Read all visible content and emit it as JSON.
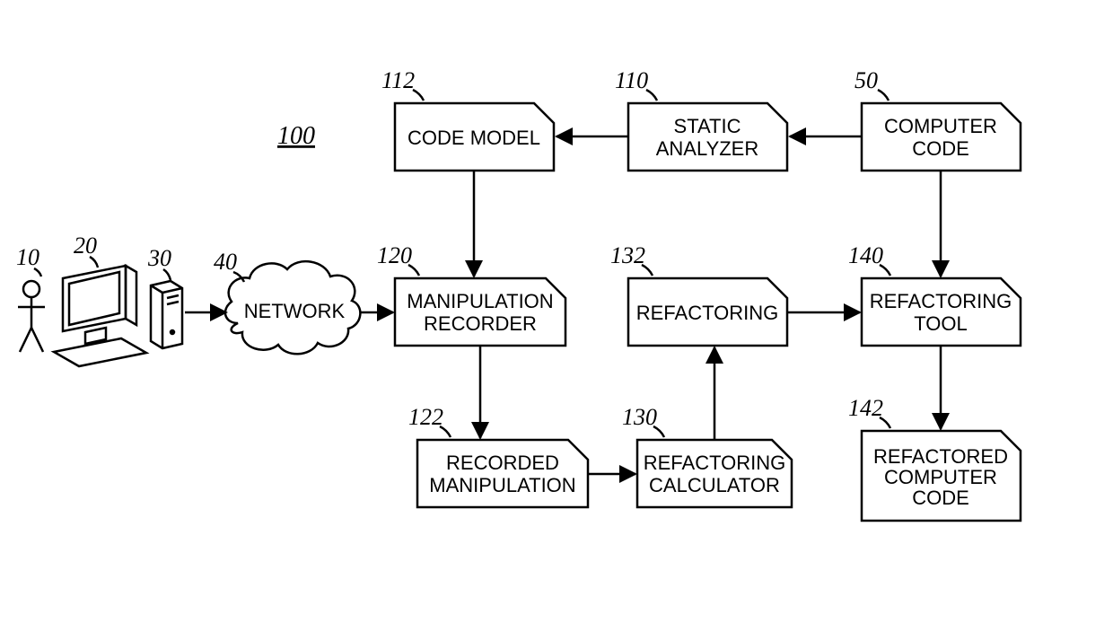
{
  "title": "100",
  "labels": {
    "user": "10",
    "monitor": "20",
    "tower": "30",
    "network": "40",
    "computerCode": "50",
    "staticAnalyzer": "110",
    "codeModel": "112",
    "manipRecorder": "120",
    "recordedManip": "122",
    "refactorCalc": "130",
    "refactoring": "132",
    "refactorTool": "140",
    "refactoredCode": "142"
  },
  "blocks": {
    "network": "NETWORK",
    "codeModel": "CODE MODEL",
    "staticAnalyzer": [
      "STATIC",
      "ANALYZER"
    ],
    "computerCode": [
      "COMPUTER",
      "CODE"
    ],
    "manipRecorder": [
      "MANIPULATION",
      "RECORDER"
    ],
    "refactoring": "REFACTORING",
    "refactorTool": [
      "REFACTORING",
      "TOOL"
    ],
    "recordedManip": [
      "RECORDED",
      "MANIPULATION"
    ],
    "refactorCalc": [
      "REFACTORING",
      "CALCULATOR"
    ],
    "refactoredCode": [
      "REFACTORED",
      "COMPUTER",
      "CODE"
    ]
  }
}
